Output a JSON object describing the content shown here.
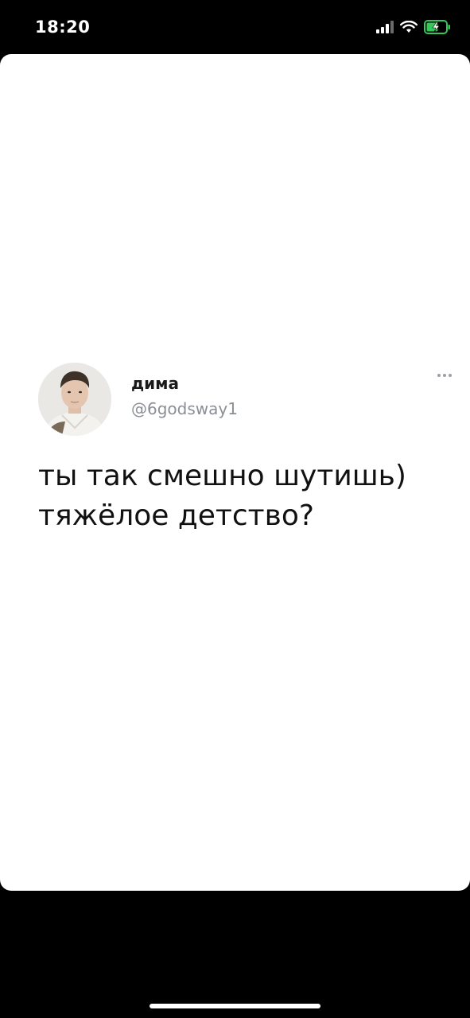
{
  "status_bar": {
    "time": "18:20",
    "signal_icon": "cellular-signal-icon",
    "wifi_icon": "wifi-icon",
    "battery_icon": "battery-charging-icon",
    "battery_color": "#34c759"
  },
  "tweet": {
    "author_name": "дима",
    "author_handle": "@6godsway1",
    "text": "ты так смешно шутишь)\nтяжёлое детство?",
    "more_icon": "more-options-icon"
  },
  "colors": {
    "background": "#000000",
    "card": "#ffffff",
    "text": "#111111",
    "muted": "#8a8f96"
  }
}
